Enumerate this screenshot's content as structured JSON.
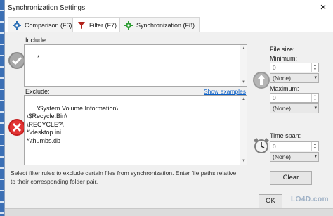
{
  "window": {
    "title": "Synchronization Settings",
    "close": "×"
  },
  "tabs": [
    {
      "label": "Comparison (F6)",
      "icon": "gear-icon",
      "color": "#2c6fb5"
    },
    {
      "label": "Filter (F7)",
      "icon": "funnel-icon",
      "color": "#b3221b"
    },
    {
      "label": "Synchronization (F8)",
      "icon": "gear-icon",
      "color": "#2f9e35"
    }
  ],
  "include": {
    "label": "Include:",
    "value": "*"
  },
  "exclude": {
    "label": "Exclude:",
    "link": "Show examples",
    "value": "\\System Volume Information\\\n\\$Recycle.Bin\\\n\\RECYCLE?\\\n*\\desktop.ini\n*\\thumbs.db"
  },
  "filesize": {
    "label": "File size:",
    "min_label": "Minimum:",
    "min_value": "0",
    "min_unit": "(None)",
    "max_label": "Maximum:",
    "max_value": "0",
    "max_unit": "(None)"
  },
  "timespan": {
    "label": "Time span:",
    "value": "0",
    "unit": "(None)"
  },
  "buttons": {
    "clear": "Clear",
    "ok": "OK"
  },
  "status": "Select filter rules to exclude certain files from synchronization. Enter file paths relative to their corresponding folder pair.",
  "watermark": "LO4D.com"
}
